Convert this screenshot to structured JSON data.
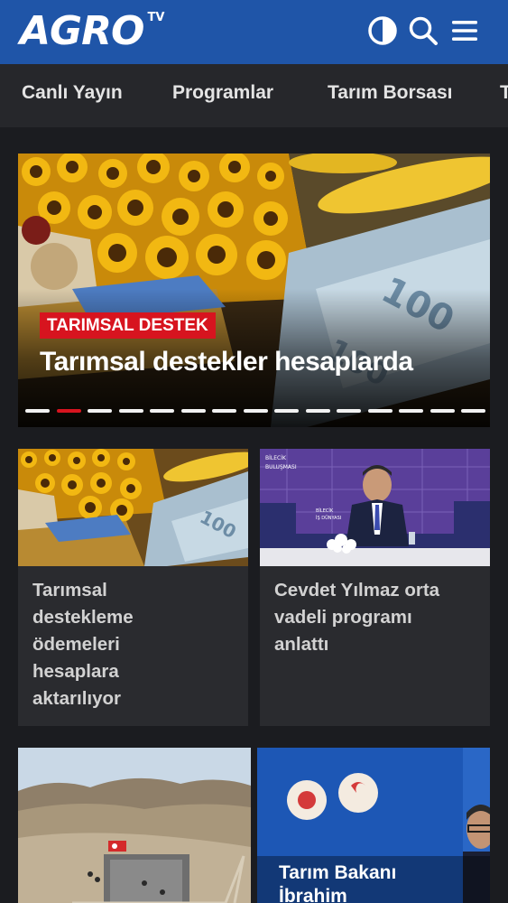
{
  "header": {
    "logo_text": "AGRO",
    "logo_sub": "TV",
    "icons": [
      "contrast-icon",
      "search-icon",
      "menu-icon"
    ]
  },
  "nav": {
    "items": [
      {
        "label": "Canlı Yayın"
      },
      {
        "label": "Programlar"
      },
      {
        "label": "Tarım Borsası"
      },
      {
        "label": "T"
      }
    ]
  },
  "hero": {
    "category": "TARIMSAL DESTEK",
    "title": "Tarımsal destekler hesaplarda",
    "slide_count": 15,
    "active_slide": 2
  },
  "cards": [
    {
      "title_lines": [
        "Tarımsal",
        "destekleme",
        "ödemeleri",
        "hesaplara",
        "aktarılıyor"
      ]
    },
    {
      "title_lines": [
        "Cevdet Yılmaz orta",
        "vadeli programı",
        "anlattı"
      ]
    },
    {
      "title_lines": []
    },
    {
      "title_lines": [
        "Tarım Bakanı",
        "İbrahim"
      ]
    }
  ],
  "colors": {
    "header_bg": "#1f55a8",
    "nav_bg": "#26272b",
    "page_bg": "#1b1c20",
    "card_bg": "#2a2b2f",
    "accent_red": "#d7141f"
  }
}
